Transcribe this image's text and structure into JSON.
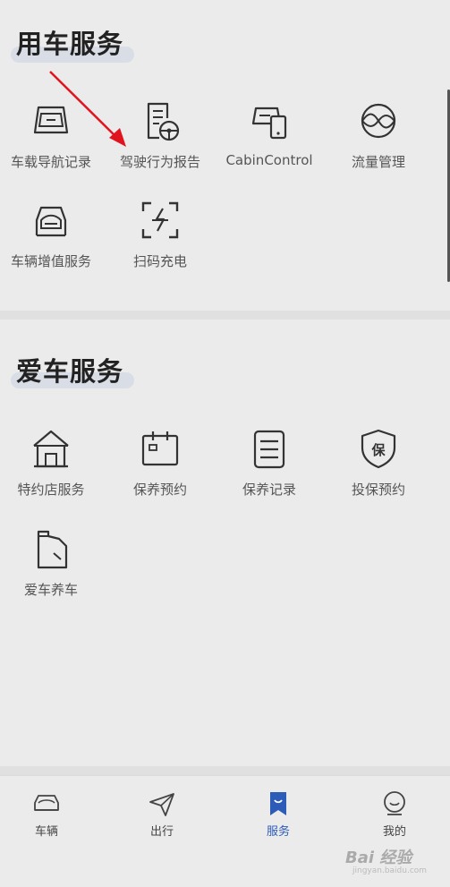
{
  "vehicle_services": {
    "title": "用车服务",
    "items": [
      {
        "label": "车载导航记录",
        "icon": "navigation-record-icon"
      },
      {
        "label": "驾驶行为报告",
        "icon": "driving-report-icon"
      },
      {
        "label": "CabinControl",
        "icon": "cabin-control-icon"
      },
      {
        "label": "流量管理",
        "icon": "data-flow-icon"
      },
      {
        "label": "车辆增值服务",
        "icon": "car-value-icon"
      },
      {
        "label": "扫码充电",
        "icon": "scan-charge-icon"
      }
    ]
  },
  "car_care_services": {
    "title": "爱车服务",
    "items": [
      {
        "label": "特约店服务",
        "icon": "dealer-store-icon"
      },
      {
        "label": "保养预约",
        "icon": "maintenance-calendar-icon"
      },
      {
        "label": "保养记录",
        "icon": "maintenance-record-icon"
      },
      {
        "label": "投保预约",
        "icon": "insurance-shield-icon"
      },
      {
        "label": "爱车养车",
        "icon": "oil-can-icon"
      }
    ]
  },
  "shield_char": "保",
  "tabbar": {
    "tabs": [
      {
        "label": "车辆",
        "icon": "car-icon",
        "active": false
      },
      {
        "label": "出行",
        "icon": "plane-icon",
        "active": false
      },
      {
        "label": "服务",
        "icon": "bookmark-icon",
        "active": true
      },
      {
        "label": "我的",
        "icon": "profile-icon",
        "active": false
      }
    ],
    "active_color": "#2d5bb8"
  },
  "watermark": {
    "text": "Bai 经验",
    "sub": "jingyan.baidu.com"
  },
  "colors": {
    "background": "#ebebeb",
    "arrow": "#e0141e",
    "icon_stroke": "#333333"
  }
}
